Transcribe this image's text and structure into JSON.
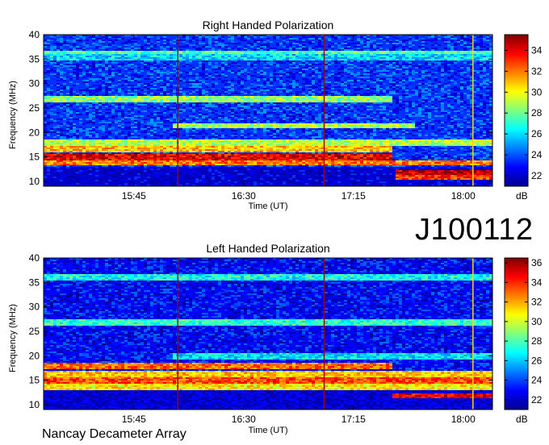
{
  "main_label": "J100112",
  "footer": "Nancay Decameter Array",
  "chart_data": [
    {
      "type": "heatmap",
      "title": "Right Handed Polarization",
      "xlabel": "Time (UT)",
      "ylabel": "Frequency (MHz)",
      "x_ticks": [
        "15:45",
        "16:30",
        "17:15",
        "18:00"
      ],
      "x_tick_minutes": [
        945,
        990,
        1035,
        1080
      ],
      "xlim_minutes": [
        908,
        1092
      ],
      "y_ticks": [
        10,
        15,
        20,
        25,
        30,
        35,
        40
      ],
      "ylim": [
        9,
        40
      ],
      "colorbar": {
        "label": "dB",
        "ticks": [
          22,
          24,
          26,
          28,
          30,
          32,
          34
        ],
        "range": [
          21,
          35.5
        ]
      },
      "vertical_lines_minutes": [
        963,
        1023,
        1084
      ],
      "background_db": 23.5,
      "bands": [
        {
          "f": 36.2,
          "db": 27.5,
          "from": 908,
          "to": 1092
        },
        {
          "f": 35.5,
          "db": 26.0,
          "from": 908,
          "to": 1092
        },
        {
          "f": 27.0,
          "db": 28.5,
          "from": 908,
          "to": 1050
        },
        {
          "f": 21.5,
          "db": 29.0,
          "from": 960,
          "to": 1060
        },
        {
          "f": 18.0,
          "db": 29.0,
          "from": 908,
          "to": 1092
        },
        {
          "f": 16.8,
          "db": 31.0,
          "from": 908,
          "to": 1050
        },
        {
          "f": 15.2,
          "db": 34.0,
          "from": 908,
          "to": 1050
        },
        {
          "f": 14.0,
          "db": 32.0,
          "from": 908,
          "to": 1092
        },
        {
          "f": 12.0,
          "db": 34.5,
          "from": 1052,
          "to": 1092
        },
        {
          "f": 11.0,
          "db": 33.0,
          "from": 1052,
          "to": 1092
        }
      ],
      "low_band": {
        "below": 13.2,
        "db": 21.5
      }
    },
    {
      "type": "heatmap",
      "title": "Left Handed Polarization",
      "xlabel": "Time (UT)",
      "ylabel": "Frequency (MHz)",
      "x_ticks": [
        "15:45",
        "16:30",
        "17:15",
        "18:00"
      ],
      "x_tick_minutes": [
        945,
        990,
        1035,
        1080
      ],
      "xlim_minutes": [
        908,
        1092
      ],
      "y_ticks": [
        10,
        15,
        20,
        25,
        30,
        35,
        40
      ],
      "ylim": [
        9,
        40
      ],
      "colorbar": {
        "label": "dB",
        "ticks": [
          22,
          24,
          26,
          28,
          30,
          32,
          34,
          36
        ],
        "range": [
          21,
          36.5
        ]
      },
      "vertical_lines_minutes": [
        963,
        1023,
        1084
      ],
      "background_db": 23.0,
      "bands": [
        {
          "f": 36.2,
          "db": 27.0,
          "from": 908,
          "to": 1092
        },
        {
          "f": 27.0,
          "db": 27.5,
          "from": 908,
          "to": 1092
        },
        {
          "f": 20.0,
          "db": 26.5,
          "from": 960,
          "to": 1092
        },
        {
          "f": 18.0,
          "db": 33.0,
          "from": 908,
          "to": 1050
        },
        {
          "f": 16.5,
          "db": 31.5,
          "from": 908,
          "to": 1092
        },
        {
          "f": 15.0,
          "db": 33.5,
          "from": 908,
          "to": 1092
        },
        {
          "f": 13.8,
          "db": 31.0,
          "from": 908,
          "to": 1092
        },
        {
          "f": 12.0,
          "db": 35.0,
          "from": 1050,
          "to": 1092
        }
      ],
      "low_band": {
        "below": 13.0,
        "db": 21.5
      }
    }
  ]
}
